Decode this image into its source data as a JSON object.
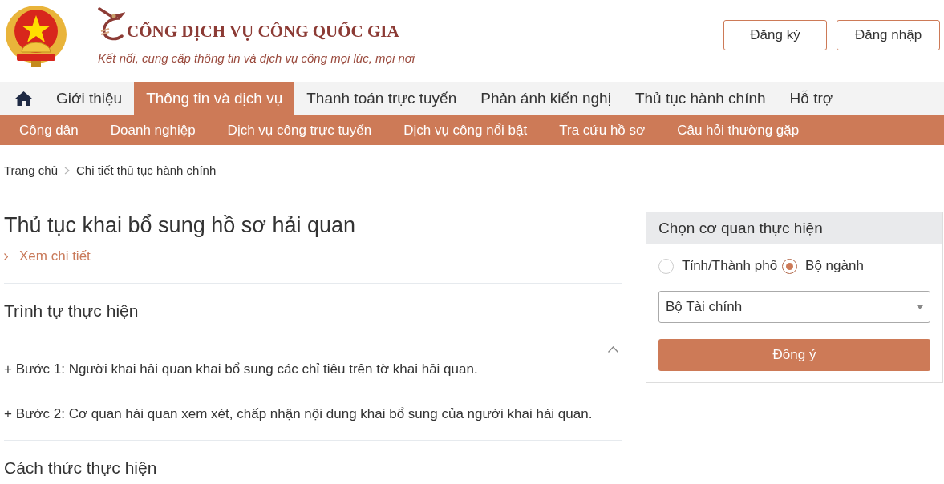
{
  "header": {
    "title": "CỔNG DỊCH VỤ CÔNG QUỐC GIA",
    "tagline": "Kết nối, cung cấp thông tin và dịch vụ công mọi lúc, mọi nơi",
    "buttons": [
      "Đăng ký",
      "Đăng nhập"
    ]
  },
  "main_nav": [
    {
      "label": "Giới thiệu",
      "selected": false
    },
    {
      "label": "Thông tin và dịch vụ",
      "selected": true
    },
    {
      "label": "Thanh toán trực tuyến",
      "selected": false
    },
    {
      "label": "Phản ánh kiến nghị",
      "selected": false
    },
    {
      "label": "Thủ tục hành chính",
      "selected": false
    },
    {
      "label": "Hỗ trợ",
      "selected": false
    }
  ],
  "sub_nav": [
    "Công dân",
    "Doanh nghiệp",
    "Dịch vụ công trực tuyến",
    "Dịch vụ công nổi bật",
    "Tra cứu hồ sơ",
    "Câu hỏi thường gặp"
  ],
  "breadcrumb": [
    "Trang chủ",
    "Chi tiết thủ tục hành chính"
  ],
  "procedure": {
    "title": "Thủ tục khai bổ sung hồ sơ hải quan",
    "detail_link": "Xem chi tiết",
    "sequence_section": {
      "heading": "Trình tự thực hiện",
      "expanded": true,
      "steps": [
        "+ Bước 1: Người khai hải quan khai bổ sung các chỉ tiêu trên tờ khai hải quan.",
        "+ Bước 2: Cơ quan hải quan xem xét, chấp nhận nội dung khai bổ sung của người khai hải quan."
      ]
    },
    "next_section": {
      "heading": "Cách thức thực hiện"
    }
  },
  "agency_panel": {
    "title": "Chọn cơ quan thực hiện",
    "options": [
      {
        "label": "Tỉnh/Thành phố",
        "selected": false
      },
      {
        "label": "Bộ ngành",
        "selected": true
      }
    ],
    "select": {
      "value": "Bộ Tài chính"
    },
    "submit": "Đồng ý"
  }
}
